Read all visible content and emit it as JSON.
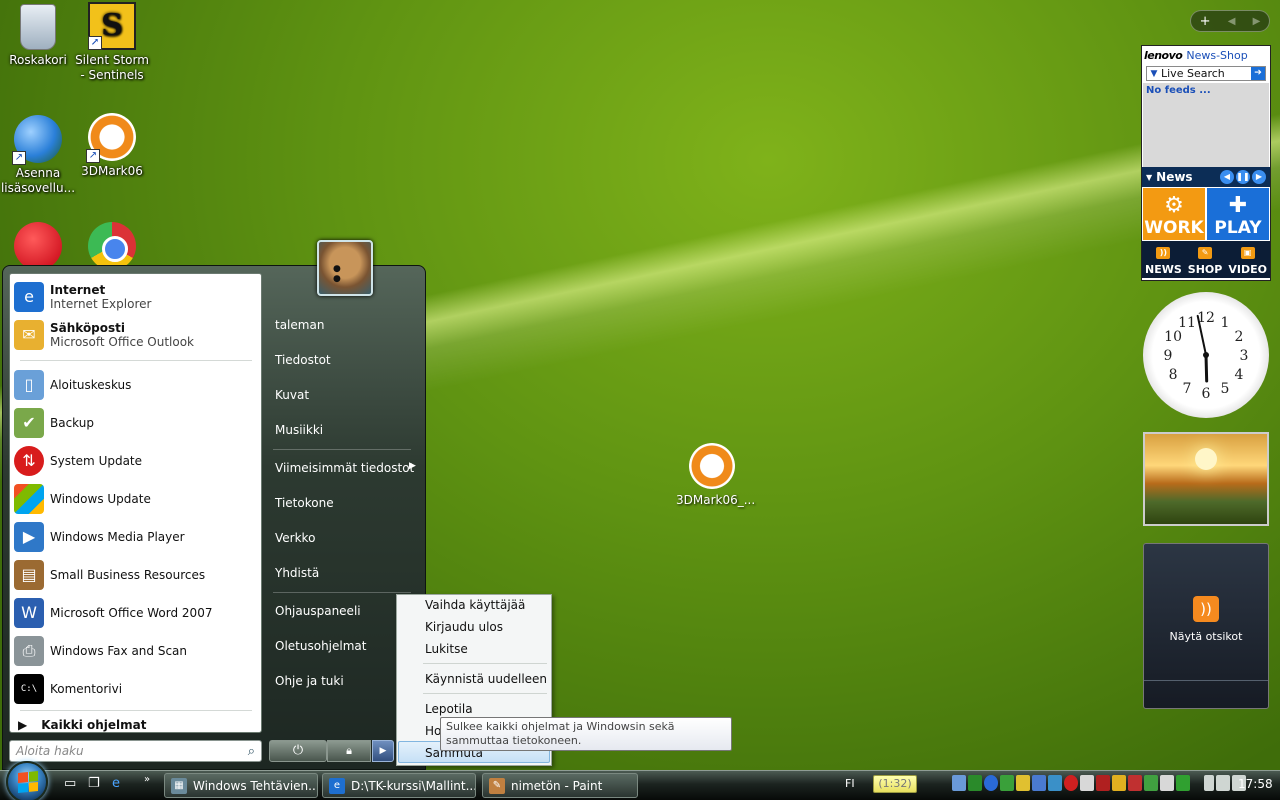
{
  "desktop": {
    "icons": [
      {
        "label": "Roskakori"
      },
      {
        "label": "Silent Storm - Sentinels"
      },
      {
        "label": "Asenna lisäsovellu..."
      },
      {
        "label": "3DMark06"
      },
      {
        "label": "3DMark06_..."
      }
    ]
  },
  "lenovo_gadget": {
    "brand": "lenovo",
    "shop": "News-Shop",
    "search_label": "Live Search",
    "feeds_text": "No feeds ...",
    "news_label": "News",
    "work": "WORK",
    "play": "PLAY",
    "bottom": [
      "NEWS",
      "SHOP",
      "VIDEO"
    ]
  },
  "clock": {
    "numbers": [
      "12",
      "1",
      "2",
      "3",
      "4",
      "5",
      "6",
      "7",
      "8",
      "9",
      "10",
      "11"
    ],
    "hour": 5.95,
    "minute": 58
  },
  "feed_gadget": {
    "label": "Näytä otsikot"
  },
  "start_menu": {
    "pinned": [
      {
        "title": "Internet",
        "subtitle": "Internet Explorer"
      },
      {
        "title": "Sähköposti",
        "subtitle": "Microsoft Office Outlook"
      }
    ],
    "recent": [
      "Aloituskeskus",
      "Backup",
      "System Update",
      "Windows Update",
      "Windows Media Player",
      "Small Business Resources",
      "Microsoft Office Word 2007",
      "Windows Fax and Scan",
      "Komentorivi"
    ],
    "all_programs": "Kaikki ohjelmat",
    "search_placeholder": "Aloita haku",
    "right": {
      "user": "taleman",
      "documents": "Tiedostot",
      "pictures": "Kuvat",
      "music": "Musiikki",
      "recent_files": "Viimeisimmät tiedostot",
      "computer": "Tietokone",
      "network": "Verkko",
      "connect": "Yhdistä",
      "control_panel": "Ohjauspaneeli",
      "default_programs": "Oletusohjelmat",
      "help": "Ohje ja tuki"
    },
    "power_submenu": {
      "switch_user": "Vaihda käyttäjää",
      "log_off": "Kirjaudu ulos",
      "lock": "Lukitse",
      "restart": "Käynnistä uudelleen",
      "sleep": "Lepotila",
      "hibernate_partial": "Ho",
      "shutdown_partial": "Sammuta"
    },
    "tooltip": "Sulkee kaikki ohjelmat ja Windowsin sekä sammuttaa tietokoneen."
  },
  "taskbar": {
    "tasks": [
      "Windows Tehtävien...",
      "D:\\TK-kurssi\\Mallint...",
      "nimetön - Paint"
    ],
    "language": "FI",
    "battery": "(1:32)",
    "time": "17:58"
  },
  "colors": {
    "work": "#f39a12",
    "play": "#1a6fd8",
    "highlight": "#c6e0f6"
  }
}
